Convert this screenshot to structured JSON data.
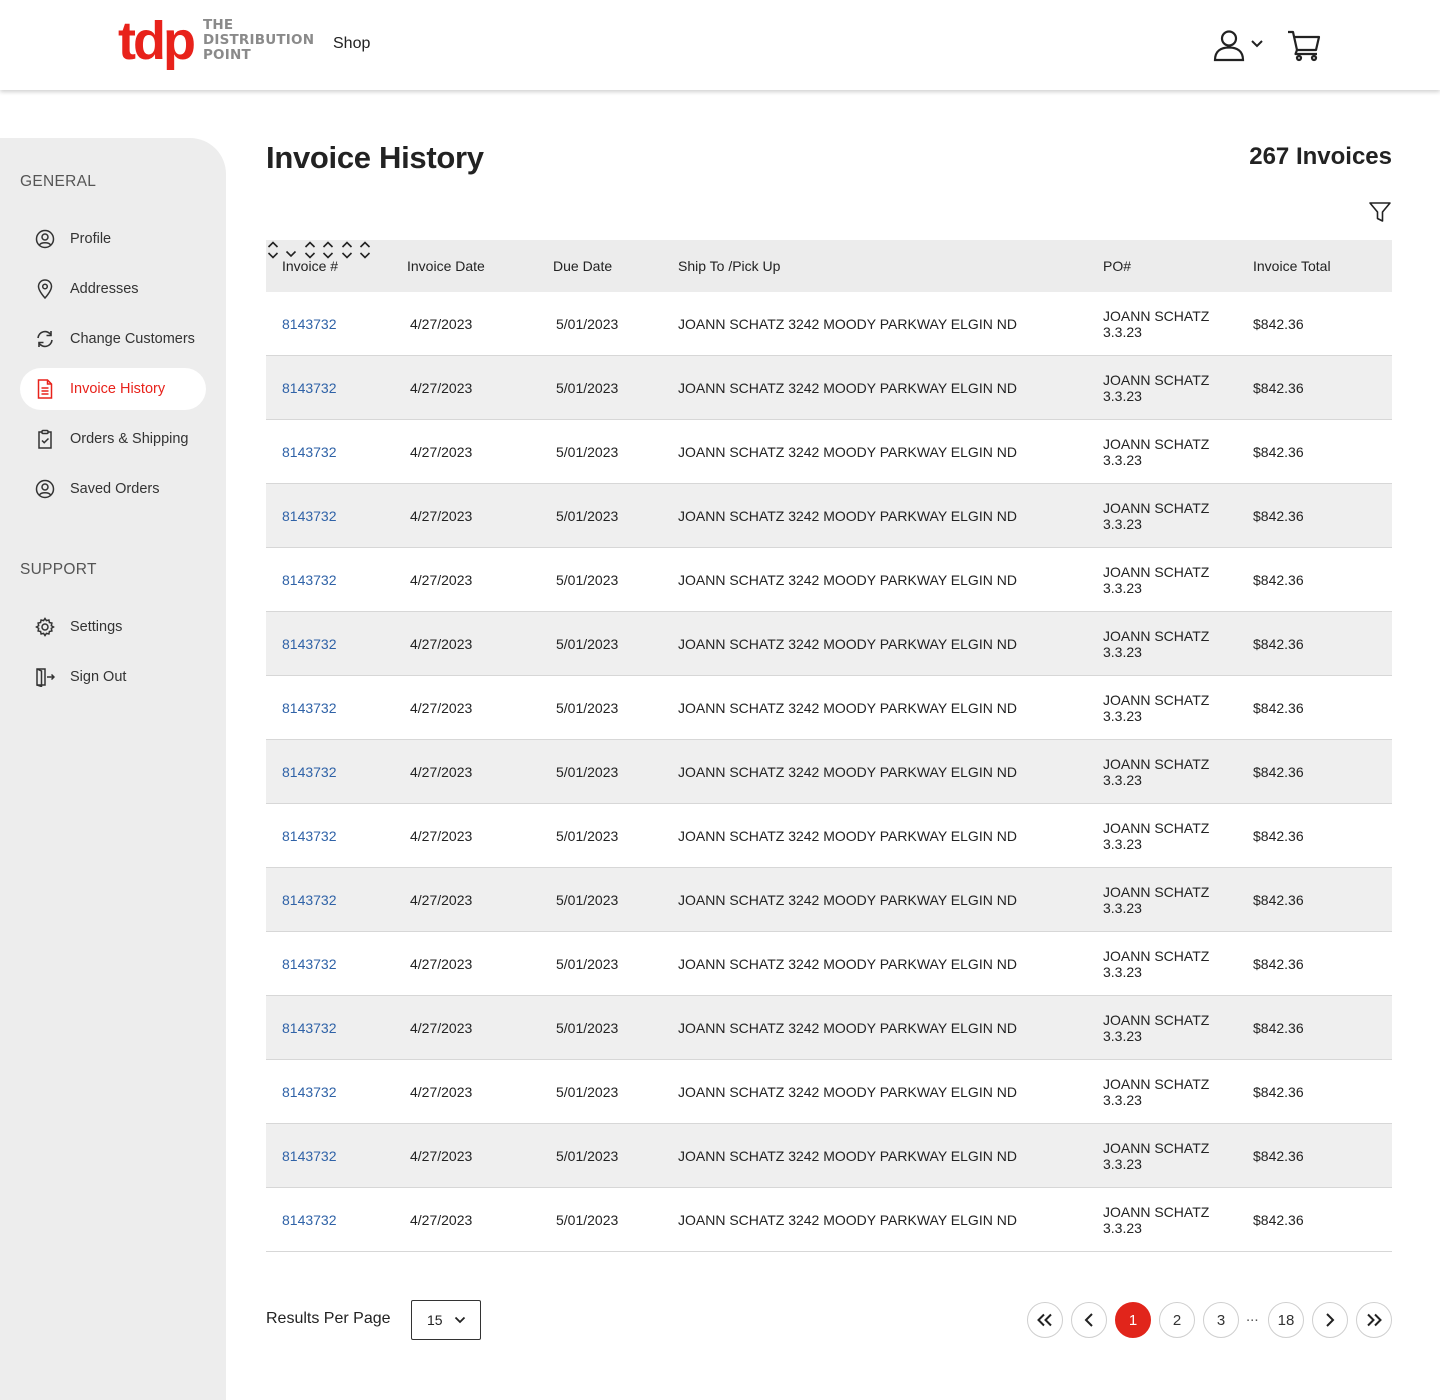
{
  "header": {
    "logo": {
      "mark": "tdp",
      "line1": "THE",
      "line2": "DISTRIBUTION",
      "line3": "POINT"
    },
    "nav_shop": "Shop"
  },
  "sidebar": {
    "general_title": "GENERAL",
    "general_items": [
      {
        "label": "Profile",
        "icon": "user-circle-icon"
      },
      {
        "label": "Addresses",
        "icon": "map-pin-icon"
      },
      {
        "label": "Change Customers",
        "icon": "refresh-icon"
      },
      {
        "label": "Invoice History",
        "icon": "document-icon",
        "active": true
      },
      {
        "label": "Orders & Shipping",
        "icon": "clipboard-check-icon"
      },
      {
        "label": "Saved Orders",
        "icon": "user-circle-icon"
      }
    ],
    "support_title": "SUPPORT",
    "support_items": [
      {
        "label": "Settings",
        "icon": "gear-icon"
      },
      {
        "label": "Sign Out",
        "icon": "sign-out-icon"
      }
    ]
  },
  "main": {
    "title": "Invoice History",
    "count": "267 Invoices",
    "columns": [
      "Invoice #",
      "Invoice Date",
      "Due Date",
      "Ship To /Pick Up",
      "PO#",
      "Invoice Total"
    ],
    "rows": [
      {
        "invoice": "8143732",
        "invoice_date": "4/27/2023",
        "due_date": "5/01/2023",
        "ship_to": "JOANN SCHATZ 3242 MOODY PARKWAY ELGIN ND",
        "po_line1": "JOANN SCHATZ",
        "po_line2": "3.3.23",
        "total": "$842.36"
      },
      {
        "invoice": "8143732",
        "invoice_date": "4/27/2023",
        "due_date": "5/01/2023",
        "ship_to": "JOANN SCHATZ 3242 MOODY PARKWAY ELGIN ND",
        "po_line1": "JOANN SCHATZ",
        "po_line2": "3.3.23",
        "total": "$842.36"
      },
      {
        "invoice": "8143732",
        "invoice_date": "4/27/2023",
        "due_date": "5/01/2023",
        "ship_to": "JOANN SCHATZ 3242 MOODY PARKWAY ELGIN ND",
        "po_line1": "JOANN SCHATZ",
        "po_line2": "3.3.23",
        "total": "$842.36"
      },
      {
        "invoice": "8143732",
        "invoice_date": "4/27/2023",
        "due_date": "5/01/2023",
        "ship_to": "JOANN SCHATZ 3242 MOODY PARKWAY ELGIN ND",
        "po_line1": "JOANN SCHATZ",
        "po_line2": "3.3.23",
        "total": "$842.36"
      },
      {
        "invoice": "8143732",
        "invoice_date": "4/27/2023",
        "due_date": "5/01/2023",
        "ship_to": "JOANN SCHATZ 3242 MOODY PARKWAY ELGIN ND",
        "po_line1": "JOANN SCHATZ",
        "po_line2": "3.3.23",
        "total": "$842.36"
      },
      {
        "invoice": "8143732",
        "invoice_date": "4/27/2023",
        "due_date": "5/01/2023",
        "ship_to": "JOANN SCHATZ 3242 MOODY PARKWAY ELGIN ND",
        "po_line1": "JOANN SCHATZ",
        "po_line2": "3.3.23",
        "total": "$842.36"
      },
      {
        "invoice": "8143732",
        "invoice_date": "4/27/2023",
        "due_date": "5/01/2023",
        "ship_to": "JOANN SCHATZ 3242 MOODY PARKWAY ELGIN ND",
        "po_line1": "JOANN SCHATZ",
        "po_line2": "3.3.23",
        "total": "$842.36"
      },
      {
        "invoice": "8143732",
        "invoice_date": "4/27/2023",
        "due_date": "5/01/2023",
        "ship_to": "JOANN SCHATZ 3242 MOODY PARKWAY ELGIN ND",
        "po_line1": "JOANN SCHATZ",
        "po_line2": "3.3.23",
        "total": "$842.36"
      },
      {
        "invoice": "8143732",
        "invoice_date": "4/27/2023",
        "due_date": "5/01/2023",
        "ship_to": "JOANN SCHATZ 3242 MOODY PARKWAY ELGIN ND",
        "po_line1": "JOANN SCHATZ",
        "po_line2": "3.3.23",
        "total": "$842.36"
      },
      {
        "invoice": "8143732",
        "invoice_date": "4/27/2023",
        "due_date": "5/01/2023",
        "ship_to": "JOANN SCHATZ 3242 MOODY PARKWAY ELGIN ND",
        "po_line1": "JOANN SCHATZ",
        "po_line2": "3.3.23",
        "total": "$842.36"
      },
      {
        "invoice": "8143732",
        "invoice_date": "4/27/2023",
        "due_date": "5/01/2023",
        "ship_to": "JOANN SCHATZ 3242 MOODY PARKWAY ELGIN ND",
        "po_line1": "JOANN SCHATZ",
        "po_line2": "3.3.23",
        "total": "$842.36"
      },
      {
        "invoice": "8143732",
        "invoice_date": "4/27/2023",
        "due_date": "5/01/2023",
        "ship_to": "JOANN SCHATZ 3242 MOODY PARKWAY ELGIN ND",
        "po_line1": "JOANN SCHATZ",
        "po_line2": "3.3.23",
        "total": "$842.36"
      },
      {
        "invoice": "8143732",
        "invoice_date": "4/27/2023",
        "due_date": "5/01/2023",
        "ship_to": "JOANN SCHATZ 3242 MOODY PARKWAY ELGIN ND",
        "po_line1": "JOANN SCHATZ",
        "po_line2": "3.3.23",
        "total": "$842.36"
      },
      {
        "invoice": "8143732",
        "invoice_date": "4/27/2023",
        "due_date": "5/01/2023",
        "ship_to": "JOANN SCHATZ 3242 MOODY PARKWAY ELGIN ND",
        "po_line1": "JOANN SCHATZ",
        "po_line2": "3.3.23",
        "total": "$842.36"
      },
      {
        "invoice": "8143732",
        "invoice_date": "4/27/2023",
        "due_date": "5/01/2023",
        "ship_to": "JOANN SCHATZ 3242 MOODY PARKWAY ELGIN ND",
        "po_line1": "JOANN SCHATZ",
        "po_line2": "3.3.23",
        "total": "$842.36"
      }
    ]
  },
  "footer": {
    "results_per_page_label": "Results Per Page",
    "results_per_page_value": "15",
    "pages": [
      "1",
      "2",
      "3"
    ],
    "ellipsis": "...",
    "last_page": "18",
    "current_page": "1"
  },
  "colors": {
    "brand_red": "#e8221b",
    "link_blue": "#2f62a7",
    "header_bg": "#ececec",
    "row_alt_bg": "#efefef",
    "sidebar_bg": "#ededed"
  }
}
